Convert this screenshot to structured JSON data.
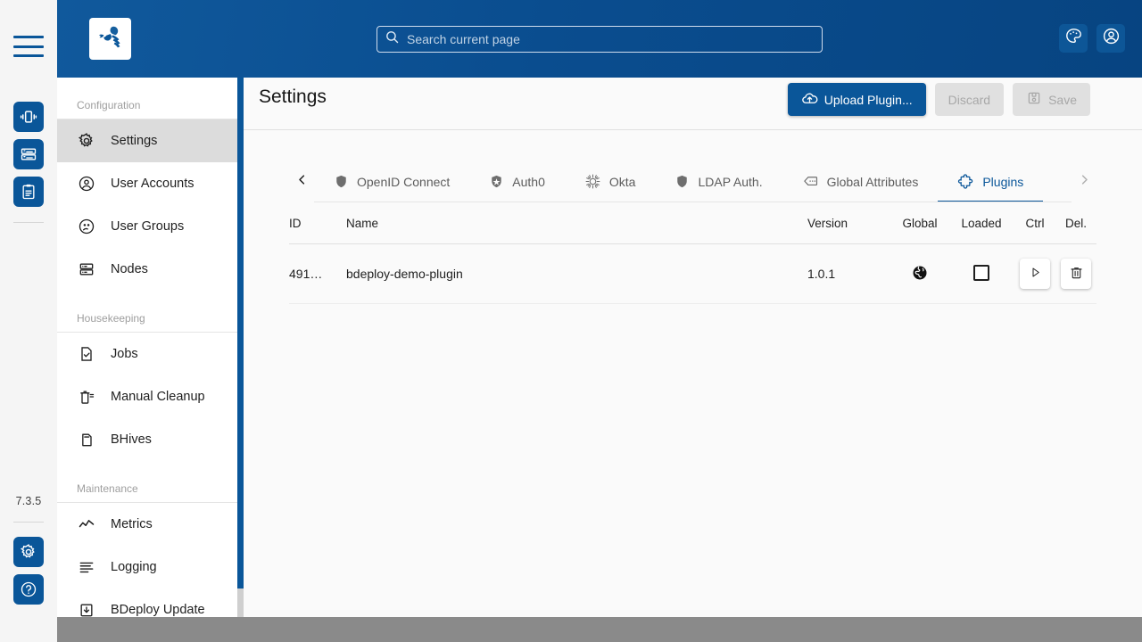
{
  "app": {
    "version": "7.3.5",
    "logo_icon": "bee-logo-icon"
  },
  "rail": {
    "menu_icon": "hamburger-menu-icon",
    "buttons": [
      {
        "name": "instance-groups-icon",
        "icon": "instance-groups-icon"
      },
      {
        "name": "system-software-icon",
        "icon": "server-list-icon"
      },
      {
        "name": "reports-icon",
        "icon": "clipboard-icon"
      }
    ],
    "bottom_buttons": [
      {
        "name": "admin-settings-icon",
        "icon": "gear-icon"
      },
      {
        "name": "help-icon",
        "icon": "question-circle-icon"
      }
    ]
  },
  "header": {
    "search": {
      "placeholder": "Search current page",
      "value": "",
      "icon": "search-icon"
    },
    "theme_button": {
      "label": "Theme",
      "icon": "palette-icon"
    },
    "account_button": {
      "label": "Account",
      "icon": "user-circle-icon"
    }
  },
  "sidebar": {
    "groups": [
      {
        "label": "Configuration",
        "items": [
          {
            "label": "Settings",
            "icon": "gear-icon",
            "active": true
          },
          {
            "label": "User Accounts",
            "icon": "user-circle-icon",
            "active": false
          },
          {
            "label": "User Groups",
            "icon": "user-group-icon",
            "active": false
          },
          {
            "label": "Nodes",
            "icon": "server-rack-icon",
            "active": false
          }
        ]
      },
      {
        "label": "Housekeeping",
        "items": [
          {
            "label": "Jobs",
            "icon": "document-check-icon",
            "active": false
          },
          {
            "label": "Manual Cleanup",
            "icon": "cleanup-icon",
            "active": false
          },
          {
            "label": "BHives",
            "icon": "hive-icon",
            "active": false
          }
        ]
      },
      {
        "label": "Maintenance",
        "items": [
          {
            "label": "Metrics",
            "icon": "line-chart-icon",
            "active": false
          },
          {
            "label": "Logging",
            "icon": "log-lines-icon",
            "active": false
          },
          {
            "label": "BDeploy Update",
            "icon": "download-box-icon",
            "active": false
          }
        ]
      }
    ]
  },
  "page": {
    "title": "Settings",
    "actions": {
      "upload": {
        "label": "Upload Plugin...",
        "icon": "cloud-upload-icon",
        "disabled": false
      },
      "discard": {
        "label": "Discard",
        "icon": "",
        "disabled": true
      },
      "save": {
        "label": "Save",
        "icon": "save-disk-icon",
        "disabled": true
      }
    }
  },
  "tabs": {
    "prev_icon": "chevron-left-icon",
    "next_icon": "chevron-right-icon",
    "items": [
      {
        "label": "OpenID Connect",
        "icon": "shield-icon",
        "active": false
      },
      {
        "label": "Auth0",
        "icon": "auth0-shield-icon",
        "active": false
      },
      {
        "label": "Okta",
        "icon": "okta-sun-icon",
        "active": false
      },
      {
        "label": "LDAP Auth.",
        "icon": "shield-icon",
        "active": false
      },
      {
        "label": "Global Attributes",
        "icon": "comment-dots-icon",
        "active": false
      },
      {
        "label": "Plugins",
        "icon": "puzzle-piece-icon",
        "active": true
      }
    ]
  },
  "table": {
    "columns": [
      {
        "key": "id",
        "label": "ID"
      },
      {
        "key": "name",
        "label": "Name"
      },
      {
        "key": "version",
        "label": "Version"
      },
      {
        "key": "global",
        "label": "Global"
      },
      {
        "key": "loaded",
        "label": "Loaded"
      },
      {
        "key": "ctrl",
        "label": "Ctrl"
      },
      {
        "key": "del",
        "label": "Del."
      }
    ],
    "rows": [
      {
        "id": "491…",
        "name": "bdeploy-demo-plugin",
        "version": "1.0.1",
        "global_icon": "globe-icon",
        "loaded_checked": false,
        "ctrl_icon": "play-icon",
        "del_icon": "trash-icon"
      }
    ]
  },
  "colors": {
    "brand_blue": "#0a5699",
    "header_blue": "#0d5391",
    "active_nav": "#dcdcdc",
    "page_bg": "#fafafa",
    "disabled": "#e0e0e0",
    "outside_gray": "#8a8a8a"
  }
}
